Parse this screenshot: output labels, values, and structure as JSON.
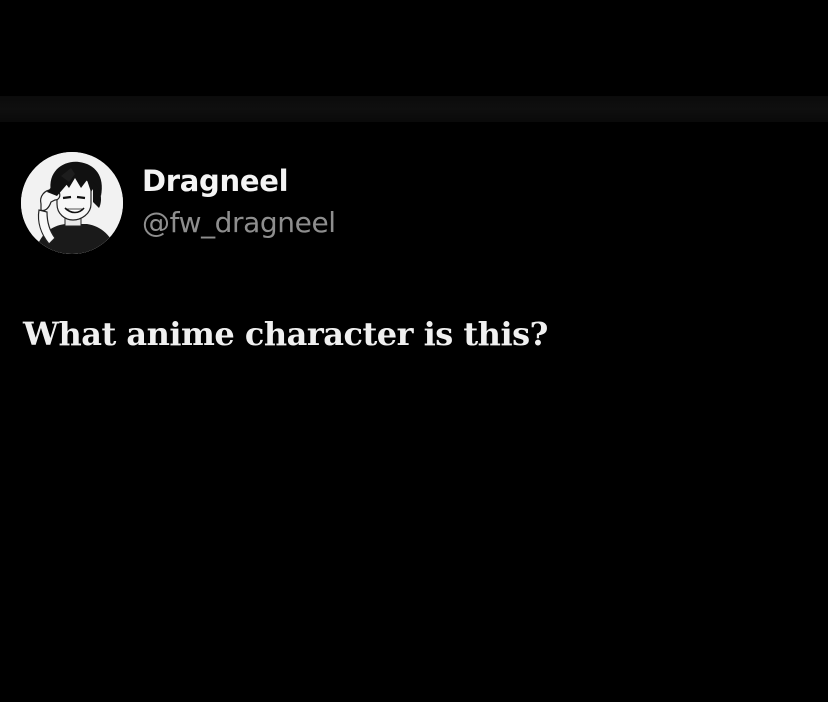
{
  "tweet": {
    "author": {
      "display_name": "Dragneel",
      "handle": "@fw_dragneel",
      "avatar": "anime-character-avatar"
    },
    "text": "What anime character is this?"
  },
  "colors": {
    "background": "#000000",
    "name_text": "#f4f4f4",
    "handle_text": "#8e8e8e",
    "body_text": "#f0f0f0"
  }
}
